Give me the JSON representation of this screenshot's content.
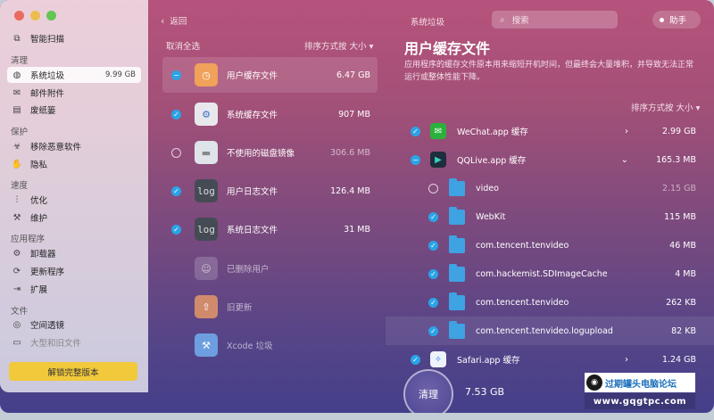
{
  "sidebar": {
    "smart_scan": "智能扫描",
    "sections": {
      "cleanup": "清理",
      "protection": "保护",
      "speed": "速度",
      "apps": "应用程序",
      "files": "文件"
    },
    "items": {
      "system_junk": "系统垃圾",
      "system_junk_size": "9.99 GB",
      "mail_attachments": "邮件附件",
      "trash": "废纸篓",
      "malware_removal": "移除恶意软件",
      "privacy": "隐私",
      "optimization": "优化",
      "maintenance": "维护",
      "uninstaller": "卸载器",
      "updater": "更新程序",
      "extensions": "扩展",
      "space_lens": "空间透镜",
      "large_old_files": "大型和旧文件"
    },
    "unlock_button": "解锁完整版本"
  },
  "middle": {
    "back": "返回",
    "deselect_all": "取消全选",
    "sort": "排序方式按 大小",
    "rows": [
      {
        "name": "用户缓存文件",
        "size": "6.47 GB"
      },
      {
        "name": "系统缓存文件",
        "size": "907 MB"
      },
      {
        "name": "不使用的磁盘镜像",
        "size": "306.6 MB"
      },
      {
        "name": "用户日志文件",
        "size": "126.4 MB"
      },
      {
        "name": "系统日志文件",
        "size": "31 MB"
      },
      {
        "name": "已删除用户",
        "size": ""
      },
      {
        "name": "旧更新",
        "size": ""
      },
      {
        "name": "Xcode 垃圾",
        "size": ""
      }
    ]
  },
  "header": {
    "title": "系统垃圾",
    "search_placeholder": "搜索",
    "assistant": "助手"
  },
  "right": {
    "title": "用户缓存文件",
    "description": "应用程序的缓存文件原本用来缩短开机时间，但最终会大量堆积，并导致无法正常运行或整体性能下降。",
    "sort": "排序方式按 大小",
    "rows": [
      {
        "name": "WeChat.app 缓存",
        "size": "2.99 GB"
      },
      {
        "name": "QQLive.app 缓存",
        "size": "165.3 MB"
      },
      {
        "name": "video",
        "size": "2.15 GB"
      },
      {
        "name": "WebKit",
        "size": "115 MB"
      },
      {
        "name": "com.tencent.tenvideo",
        "size": "46 MB"
      },
      {
        "name": "com.hackemist.SDImageCache",
        "size": "4 MB"
      },
      {
        "name": "com.tencent.tenvideo",
        "size": "262 KB"
      },
      {
        "name": "com.tencent.tenvideo.logupload",
        "size": "82 KB"
      },
      {
        "name": "Safari.app 缓存",
        "size": "1.24 GB"
      }
    ]
  },
  "footer": {
    "clean_button": "清理",
    "total": "7.53 GB"
  },
  "watermark": {
    "text": "过期罐头电脑论坛",
    "url": "www.gqgtpc.com"
  },
  "colors": {
    "accent": "#2aa3e8",
    "unlock": "#f1c93b",
    "folder": "#3ea2e3"
  }
}
